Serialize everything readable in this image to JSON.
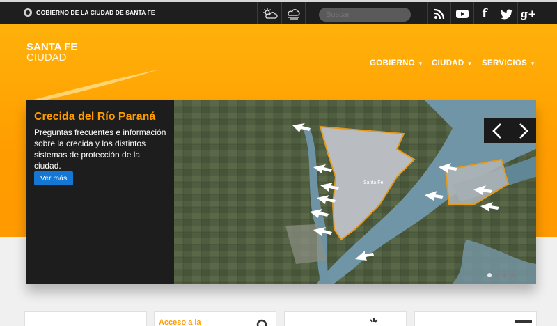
{
  "topbar": {
    "government_label": "GOBIERNO DE LA CIUDAD DE SANTA FE",
    "weather_icons": [
      "sun-cloud-icon",
      "rain-cloud-icon"
    ],
    "search": {
      "placeholder": "Buscar"
    },
    "social_icons": [
      "rss-icon",
      "youtube-icon",
      "facebook-icon",
      "twitter-icon",
      "google-plus-icon"
    ],
    "social_glyphs": {
      "facebook": "f",
      "google_plus": "g+"
    }
  },
  "header": {
    "logo": {
      "line1": "SANTA FE",
      "line2": "CIUDAD"
    },
    "nav": [
      {
        "label": "GOBIERNO",
        "caret": "▼"
      },
      {
        "label": "CIUDAD",
        "caret": "▼"
      },
      {
        "label": "SERVICIOS",
        "caret": "▼"
      }
    ]
  },
  "slider": {
    "title": "Crecida del Río Paraná",
    "text": "Preguntas frecuentes e información sobre la crecida y los distintos sistemas de protección de la ciudad.",
    "button": "Ver más",
    "prev_glyph": "‹",
    "next_glyph": "›",
    "map_label": "Santa Fe",
    "dot_count": 4,
    "active_dot": 0
  },
  "cards": [
    {
      "title": ""
    },
    {
      "title": "Acceso a la"
    },
    {
      "title": ""
    },
    {
      "title": ""
    }
  ],
  "colors": {
    "accent": "#ff9d00",
    "topbar": "#1e1e1e",
    "button": "#1477d4"
  }
}
